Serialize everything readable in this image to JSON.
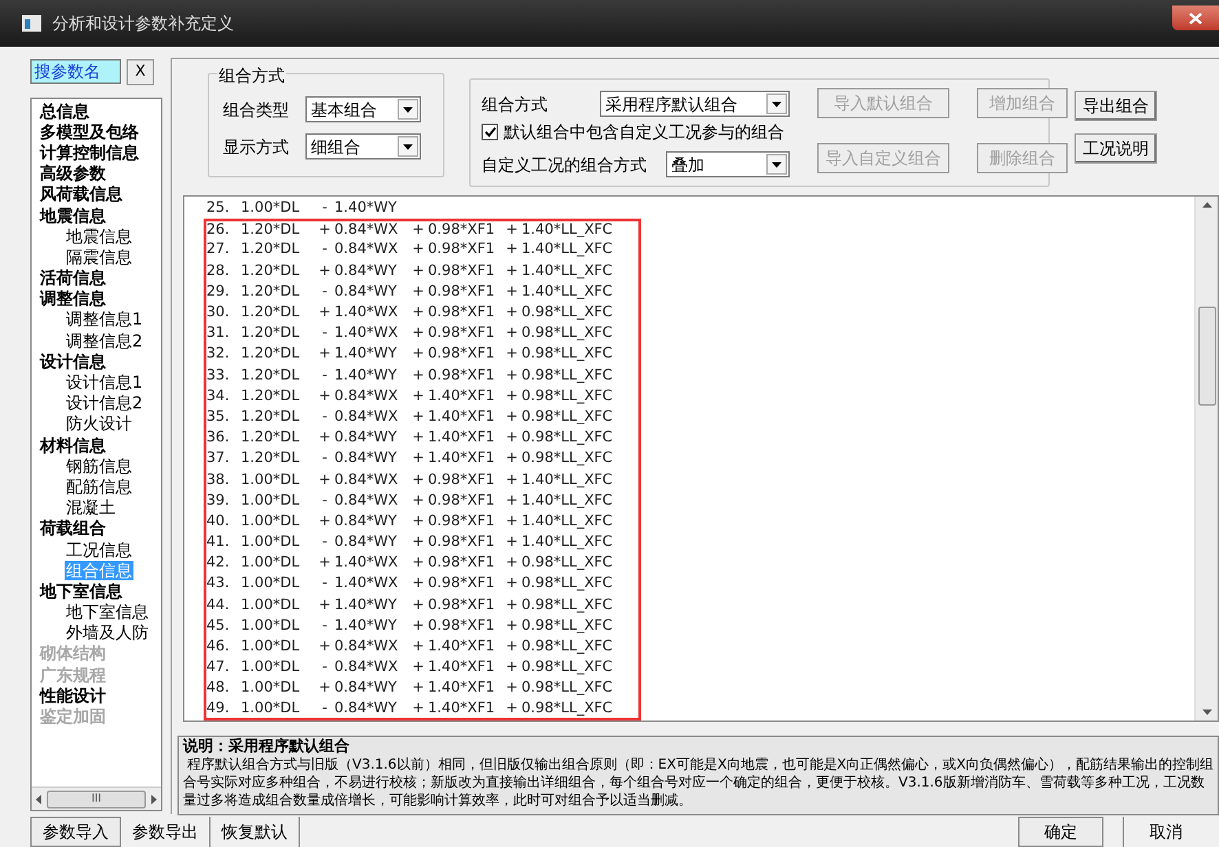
{
  "window": {
    "title": "分析和设计参数补充定义"
  },
  "search": {
    "value": "搜参数名",
    "clear_label": "X"
  },
  "sidebar": {
    "items": [
      {
        "label": "总信息",
        "selected": false,
        "disabled": false
      },
      {
        "label": "多模型及包络",
        "selected": false,
        "disabled": false
      },
      {
        "label": "计算控制信息",
        "selected": false,
        "disabled": false
      },
      {
        "label": "高级参数",
        "selected": false,
        "disabled": false
      },
      {
        "label": "风荷载信息",
        "selected": false,
        "disabled": false
      },
      {
        "label": "地震信息",
        "selected": false,
        "disabled": false,
        "children": [
          {
            "label": "地震信息",
            "selected": false,
            "disabled": false
          },
          {
            "label": "隔震信息",
            "selected": false,
            "disabled": false
          }
        ]
      },
      {
        "label": "活荷信息",
        "selected": false,
        "disabled": false
      },
      {
        "label": "调整信息",
        "selected": false,
        "disabled": false,
        "children": [
          {
            "label": "调整信息1",
            "selected": false,
            "disabled": false
          },
          {
            "label": "调整信息2",
            "selected": false,
            "disabled": false
          }
        ]
      },
      {
        "label": "设计信息",
        "selected": false,
        "disabled": false,
        "children": [
          {
            "label": "设计信息1",
            "selected": false,
            "disabled": false
          },
          {
            "label": "设计信息2",
            "selected": false,
            "disabled": false
          },
          {
            "label": "防火设计",
            "selected": false,
            "disabled": false
          }
        ]
      },
      {
        "label": "材料信息",
        "selected": false,
        "disabled": false,
        "children": [
          {
            "label": "钢筋信息",
            "selected": false,
            "disabled": false
          },
          {
            "label": "配筋信息",
            "selected": false,
            "disabled": false
          },
          {
            "label": "混凝土",
            "selected": false,
            "disabled": false
          }
        ]
      },
      {
        "label": "荷载组合",
        "selected": false,
        "disabled": false,
        "children": [
          {
            "label": "工况信息",
            "selected": false,
            "disabled": false
          },
          {
            "label": "组合信息",
            "selected": true,
            "disabled": false
          }
        ]
      },
      {
        "label": "地下室信息",
        "selected": false,
        "disabled": false,
        "children": [
          {
            "label": "地下室信息",
            "selected": false,
            "disabled": false
          },
          {
            "label": "外墙及人防",
            "selected": false,
            "disabled": false
          }
        ]
      },
      {
        "label": "砌体结构",
        "selected": false,
        "disabled": true
      },
      {
        "label": "广东规程",
        "selected": false,
        "disabled": true
      },
      {
        "label": "性能设计",
        "selected": false,
        "disabled": false
      },
      {
        "label": "鉴定加固",
        "selected": false,
        "disabled": true
      }
    ],
    "scroll_label": "III"
  },
  "combo_group": {
    "title": "组合方式",
    "fields": [
      {
        "label": "组合类型",
        "value": "基本组合"
      },
      {
        "label": "显示方式",
        "value": "细组合"
      }
    ]
  },
  "settings": {
    "method_label": "组合方式",
    "method_value": "采用程序默认组合",
    "include_custom": {
      "label": "默认组合中包含自定义工况参与的组合",
      "checked": true
    },
    "custom_label": "自定义工况的组合方式",
    "custom_value": "叠加"
  },
  "group_buttons": [
    {
      "label": "导入默认组合",
      "disabled": true
    },
    {
      "label": "增加组合",
      "disabled": true
    },
    {
      "label": "导入自定义组合",
      "disabled": true
    },
    {
      "label": "删除组合",
      "disabled": true
    }
  ],
  "side_buttons": [
    {
      "label": "导出组合",
      "disabled": false
    },
    {
      "label": "工况说明",
      "disabled": false
    }
  ],
  "combinations": [
    {
      "parts": [
        "25.",
        "1.00*DL",
        "-",
        "1.40*WY"
      ],
      "highlighted": false
    },
    {
      "parts": [
        "26.",
        "1.20*DL",
        "+",
        "0.84*WX",
        "+",
        "0.98*XF1",
        "+",
        "1.40*LL_XFC"
      ],
      "highlighted": true
    },
    {
      "parts": [
        "27.",
        "1.20*DL",
        "-",
        "0.84*WX",
        "+",
        "0.98*XF1",
        "+",
        "1.40*LL_XFC"
      ],
      "highlighted": true
    },
    {
      "parts": [
        "28.",
        "1.20*DL",
        "+",
        "0.84*WY",
        "+",
        "0.98*XF1",
        "+",
        "1.40*LL_XFC"
      ],
      "highlighted": true
    },
    {
      "parts": [
        "29.",
        "1.20*DL",
        "-",
        "0.84*WY",
        "+",
        "0.98*XF1",
        "+",
        "1.40*LL_XFC"
      ],
      "highlighted": true
    },
    {
      "parts": [
        "30.",
        "1.20*DL",
        "+",
        "1.40*WX",
        "+",
        "0.98*XF1",
        "+",
        "0.98*LL_XFC"
      ],
      "highlighted": true
    },
    {
      "parts": [
        "31.",
        "1.20*DL",
        "-",
        "1.40*WX",
        "+",
        "0.98*XF1",
        "+",
        "0.98*LL_XFC"
      ],
      "highlighted": true
    },
    {
      "parts": [
        "32.",
        "1.20*DL",
        "+",
        "1.40*WY",
        "+",
        "0.98*XF1",
        "+",
        "0.98*LL_XFC"
      ],
      "highlighted": true
    },
    {
      "parts": [
        "33.",
        "1.20*DL",
        "-",
        "1.40*WY",
        "+",
        "0.98*XF1",
        "+",
        "0.98*LL_XFC"
      ],
      "highlighted": true
    },
    {
      "parts": [
        "34.",
        "1.20*DL",
        "+",
        "0.84*WX",
        "+",
        "1.40*XF1",
        "+",
        "0.98*LL_XFC"
      ],
      "highlighted": true
    },
    {
      "parts": [
        "35.",
        "1.20*DL",
        "-",
        "0.84*WX",
        "+",
        "1.40*XF1",
        "+",
        "0.98*LL_XFC"
      ],
      "highlighted": true
    },
    {
      "parts": [
        "36.",
        "1.20*DL",
        "+",
        "0.84*WY",
        "+",
        "1.40*XF1",
        "+",
        "0.98*LL_XFC"
      ],
      "highlighted": true
    },
    {
      "parts": [
        "37.",
        "1.20*DL",
        "-",
        "0.84*WY",
        "+",
        "1.40*XF1",
        "+",
        "0.98*LL_XFC"
      ],
      "highlighted": true
    },
    {
      "parts": [
        "38.",
        "1.00*DL",
        "+",
        "0.84*WX",
        "+",
        "0.98*XF1",
        "+",
        "1.40*LL_XFC"
      ],
      "highlighted": true
    },
    {
      "parts": [
        "39.",
        "1.00*DL",
        "-",
        "0.84*WX",
        "+",
        "0.98*XF1",
        "+",
        "1.40*LL_XFC"
      ],
      "highlighted": true
    },
    {
      "parts": [
        "40.",
        "1.00*DL",
        "+",
        "0.84*WY",
        "+",
        "0.98*XF1",
        "+",
        "1.40*LL_XFC"
      ],
      "highlighted": true
    },
    {
      "parts": [
        "41.",
        "1.00*DL",
        "-",
        "0.84*WY",
        "+",
        "0.98*XF1",
        "+",
        "1.40*LL_XFC"
      ],
      "highlighted": true
    },
    {
      "parts": [
        "42.",
        "1.00*DL",
        "+",
        "1.40*WX",
        "+",
        "0.98*XF1",
        "+",
        "0.98*LL_XFC"
      ],
      "highlighted": true
    },
    {
      "parts": [
        "43.",
        "1.00*DL",
        "-",
        "1.40*WX",
        "+",
        "0.98*XF1",
        "+",
        "0.98*LL_XFC"
      ],
      "highlighted": true
    },
    {
      "parts": [
        "44.",
        "1.00*DL",
        "+",
        "1.40*WY",
        "+",
        "0.98*XF1",
        "+",
        "0.98*LL_XFC"
      ],
      "highlighted": true
    },
    {
      "parts": [
        "45.",
        "1.00*DL",
        "-",
        "1.40*WY",
        "+",
        "0.98*XF1",
        "+",
        "0.98*LL_XFC"
      ],
      "highlighted": true
    },
    {
      "parts": [
        "46.",
        "1.00*DL",
        "+",
        "0.84*WX",
        "+",
        "1.40*XF1",
        "+",
        "0.98*LL_XFC"
      ],
      "highlighted": true
    },
    {
      "parts": [
        "47.",
        "1.00*DL",
        "-",
        "0.84*WX",
        "+",
        "1.40*XF1",
        "+",
        "0.98*LL_XFC"
      ],
      "highlighted": true
    },
    {
      "parts": [
        "48.",
        "1.00*DL",
        "+",
        "0.84*WY",
        "+",
        "1.40*XF1",
        "+",
        "0.98*LL_XFC"
      ],
      "highlighted": true
    },
    {
      "parts": [
        "49.",
        "1.00*DL",
        "-",
        "0.84*WY",
        "+",
        "1.40*XF1",
        "+",
        "0.98*LL_XFC"
      ],
      "highlighted": true
    }
  ],
  "description": {
    "title": "说明：采用程序默认组合",
    "text": "程序默认组合方式与旧版（V3.1.6以前）相同，但旧版仅输出组合原则（即：EX可能是X向地震，也可能是X向正偶然偏心，或X向负偶然偏心），配筋结果输出的控制组合号实际对应多种组合，不易进行校核；新版改为直接输出详细组合，每个组合号对应一个确定的组合，更便于校核。V3.1.6版新增消防车、雪荷载等多种工况，工况数量过多将造成组合数量成倍增长，可能影响计算效率，此时可对组合予以适当删减。"
  },
  "footer_left": [
    "参数导入",
    "参数导出",
    "恢复默认"
  ],
  "footer_right": [
    "确定",
    "取消"
  ]
}
